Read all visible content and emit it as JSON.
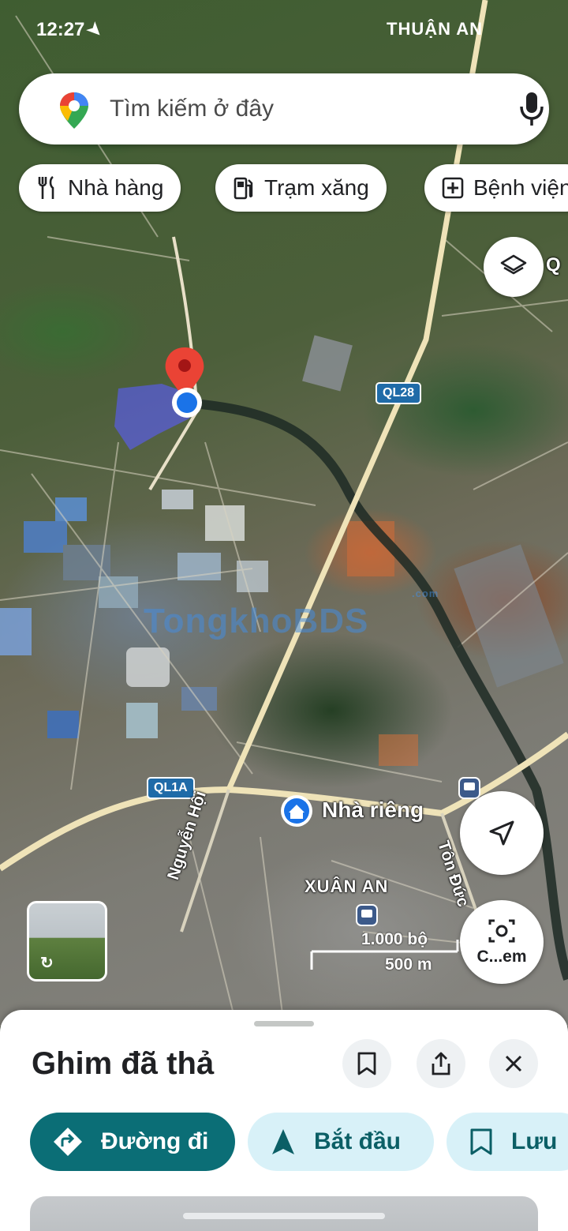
{
  "status_bar": {
    "time": "12:27",
    "area_label": "THUẬN AN"
  },
  "search": {
    "placeholder": "Tìm kiếm ở đây"
  },
  "chips": [
    {
      "label": "Nhà hàng",
      "icon": "restaurant-icon"
    },
    {
      "label": "Trạm xăng",
      "icon": "gas-station-icon"
    },
    {
      "label": "Bệnh viện",
      "icon": "hospital-icon"
    }
  ],
  "map": {
    "road_shields": {
      "ql28": "QL28",
      "ql1a": "QL1A"
    },
    "labels": {
      "home": "Nhà riêng",
      "street_nguyen_hoi": "Nguyễn Hội",
      "street_ton_duc": "Tôn Đức",
      "area_xuan_an": "XUÂN AN",
      "edge_letter": "Q"
    },
    "watermark": {
      "text": "TongkhoBDS",
      "sub": ".com"
    },
    "scale": {
      "imperial": "1.000 bộ",
      "metric": "500 m"
    },
    "lens_label": "C...em",
    "colors": {
      "pin_red": "#ea4335",
      "location_blue": "#1a73e8",
      "highlight": "#5a5cff"
    }
  },
  "sheet": {
    "title": "Ghim đã thả",
    "actions": {
      "directions": "Đường đi",
      "start": "Bắt đầu",
      "save": "Lưu"
    }
  }
}
